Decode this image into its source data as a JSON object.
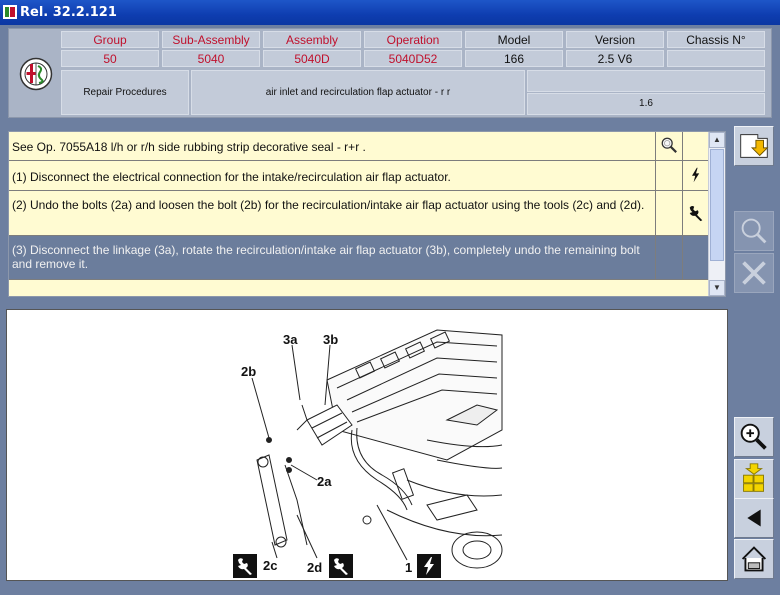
{
  "window": {
    "title": "Rel. 32.2.121"
  },
  "header": {
    "columns": [
      {
        "label": "Group",
        "value": "50"
      },
      {
        "label": "Sub-Assembly",
        "value": "5040"
      },
      {
        "label": "Assembly",
        "value": "5040D"
      },
      {
        "label": "Operation",
        "value": "5040D52"
      },
      {
        "label": "Model",
        "value": "166"
      },
      {
        "label": "Version",
        "value": "2.5 V6"
      },
      {
        "label": "Chassis N°",
        "value": ""
      }
    ],
    "section": "Repair Procedures",
    "description": "air inlet and recirculation flap actuator - r r",
    "extra_value": "1.6"
  },
  "steps": [
    {
      "text": "See Op. 7055A18 l/h or r/h side rubbing strip decorative seal - r+r  .",
      "icon1": "magnifier-icon",
      "icon2": ""
    },
    {
      "text": "(1) Disconnect the electrical connection for the intake/recirculation air flap actuator.",
      "icon1": "",
      "icon2": "electrical-icon"
    },
    {
      "text": "(2) Undo the bolts (2a) and loosen the bolt (2b) for the recirculation/intake air flap actuator using the tools (2c) and (2d).",
      "icon1": "",
      "icon2": "wrench-icon"
    },
    {
      "text": "(3) Disconnect the linkage (3a), rotate the recirculation/intake air flap actuator (3b), completely undo the remaining bolt and remove it.",
      "icon1": "",
      "icon2": ""
    }
  ],
  "diagram": {
    "labels": [
      "3a",
      "3b",
      "2b",
      "2a",
      "2c",
      "2d",
      "1"
    ]
  },
  "toolbar": {
    "buttons": [
      "export-icon",
      "search-icon",
      "tools-icon",
      "zoom-in-icon",
      "parts-icon",
      "back-icon",
      "home-icon"
    ]
  },
  "colors": {
    "title_bar": "#0e3db0",
    "header_red": "#c0102c",
    "list_bg": "#fffbd2",
    "selected_row": "#6b7d9c"
  }
}
